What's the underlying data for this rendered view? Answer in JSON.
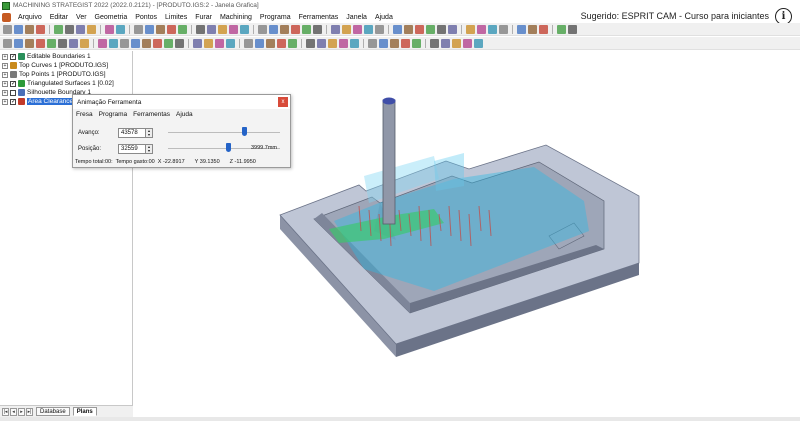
{
  "window": {
    "title": "MACHINING STRATEGIST 2022 (2022.0.2121) - [PRODUTO.IGS:2 - Janela Grafica]"
  },
  "overlay": {
    "suggestion": "Sugerido: ESPRIT CAM - Curso para iniciantes",
    "info_glyph": "i"
  },
  "menu": [
    "Arquivo",
    "Editar",
    "Ver",
    "Geometria",
    "Pontos",
    "Limites",
    "Furar",
    "Machining",
    "Programa",
    "Ferramentas",
    "Janela",
    "Ajuda"
  ],
  "tree": {
    "items": [
      {
        "label": "Editable Boundaries 1",
        "icon": "boundary-icon",
        "color": "#2a8f5a"
      },
      {
        "label": "Top Curves 1 [PRODUTO.IGS]",
        "icon": "curves-icon",
        "color": "#c98a1c"
      },
      {
        "label": "Top Points 1 [PRODUTO.IGS]",
        "icon": "points-icon",
        "color": "#7a7a7a"
      },
      {
        "label": "Triangulated Surfaces 1 [0.02]",
        "icon": "surface-icon",
        "color": "#2d9a3a"
      },
      {
        "label": "Silhouette Boundary 1",
        "icon": "silhouette-icon",
        "color": "#4a6fb8"
      },
      {
        "label": "Area Clearance",
        "icon": "toolpath-icon",
        "color": "#c23a2a"
      }
    ],
    "selected_label": "Area Clearance"
  },
  "tabs": {
    "database": "Database",
    "plans": "Plans",
    "active": "Plans"
  },
  "dialog": {
    "title": "Animação Ferramenta",
    "close_glyph": "x",
    "menu": [
      "Fresa",
      "Programa",
      "Ferramentas",
      "Ajuda"
    ],
    "feed_label": "Avanço:",
    "feed_value": "43578",
    "position_label": "Posição:",
    "position_value": "32559",
    "length_text": "3999.7mm",
    "status": {
      "total": "Tempo total:00:",
      "elapsed": "Tempo gasto:00",
      "x": "X  -22.8917",
      "y": "Y  39.1350",
      "z": "Z  -11.9950"
    }
  },
  "colors": {
    "part_fill": "#bfc6d6",
    "part_dark": "#6b7388",
    "toolpath_cyan": "#2ab9e6",
    "toolpath_green": "#39c96a",
    "toolpath_red": "#c0504d",
    "selection_blue": "#2b6fd6"
  },
  "toolbar_icons": [
    "new-icon",
    "open-icon",
    "save-icon",
    "print-icon",
    "help-icon",
    "view-icon",
    "zoom-icon",
    "rotate-icon",
    "shade-icon",
    "wire-icon"
  ]
}
